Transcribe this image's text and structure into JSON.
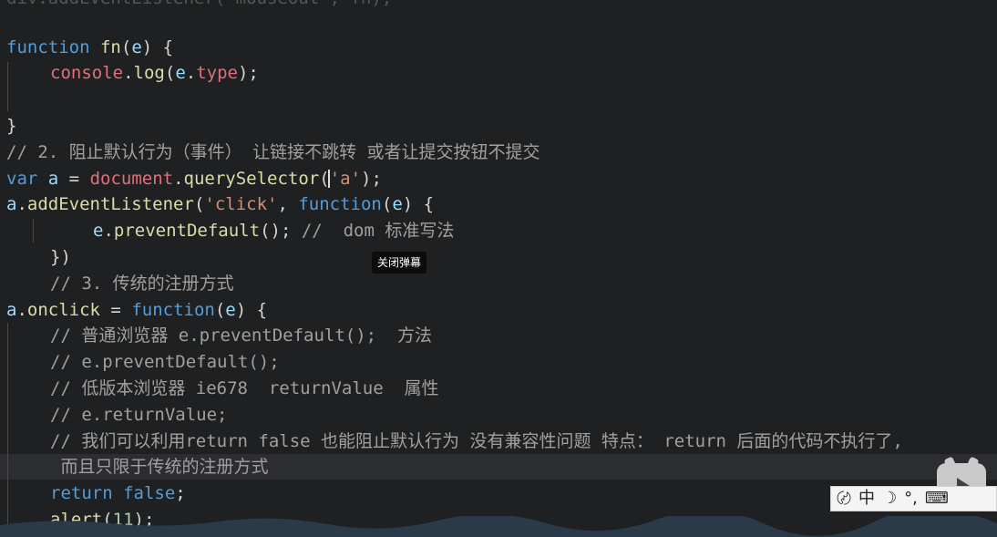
{
  "top_partial": "div.addEventListener('mouseout', fn);",
  "code": {
    "l1": {
      "kw": "function",
      "name": "fn",
      "open": "(",
      "param": "e",
      "close": ") {"
    },
    "l2": {
      "obj": "console",
      "dot": ".",
      "fn": "log",
      "open": "(",
      "id": "e",
      "dot2": ".",
      "prop": "type",
      "close": ");"
    },
    "l3": "",
    "l4": "}",
    "l5": "// 2. 阻止默认行为（事件） 让链接不跳转 或者让提交按钮不提交",
    "l6": {
      "kw": "var",
      "sp": " ",
      "id": "a",
      "eq": " = ",
      "glob": "document",
      "dot": ".",
      "fn": "querySelector",
      "open": "(",
      "str": "'a'",
      "close": ");"
    },
    "l7": {
      "id": "a",
      "dot": ".",
      "fn": "addEventListener",
      "open": "(",
      "str": "'click'",
      "comma": ", ",
      "kw": "function",
      "open2": "(",
      "param": "e",
      "close": ") {"
    },
    "l8": {
      "id": "e",
      "dot": ".",
      "fn": "preventDefault",
      "rest": "(); ",
      "cm": "//  dom 标准写法"
    },
    "l9": "})",
    "l10": "// 3. 传统的注册方式",
    "l11": {
      "id": "a",
      "dot": ".",
      "prop": "onclick",
      "eq": " = ",
      "kw": "function",
      "open": "(",
      "param": "e",
      "close": ") {"
    },
    "l12": "// 普通浏览器 e.preventDefault();  方法",
    "l13": "// e.preventDefault();",
    "l14": "// 低版本浏览器 ie678  returnValue  属性",
    "l15": "// e.returnValue;",
    "l16": "// 我们可以利用return false 也能阻止默认行为 没有兼容性问题 特点： return 后面的代码不执行了,",
    "l17": " 而且只限于传统的注册方式",
    "l18": {
      "kw": "return",
      "sp": " ",
      "kw2": "false",
      "end": ";"
    },
    "l19": {
      "fn": "alert",
      "open": "(",
      "num": "11",
      "close": ");"
    }
  },
  "overlay": {
    "tooltip": "关闭弹幕"
  },
  "ime": {
    "logo": "〄",
    "lang": "中",
    "moon": "☽",
    "dots": "°,",
    "kbd": "⌨"
  },
  "colors": {
    "background": "#1f2022",
    "keyword": "#569cd6",
    "function": "#dcdcaa",
    "string": "#ce9178",
    "comment": "#a0a0a0",
    "global": "#e0707a"
  }
}
